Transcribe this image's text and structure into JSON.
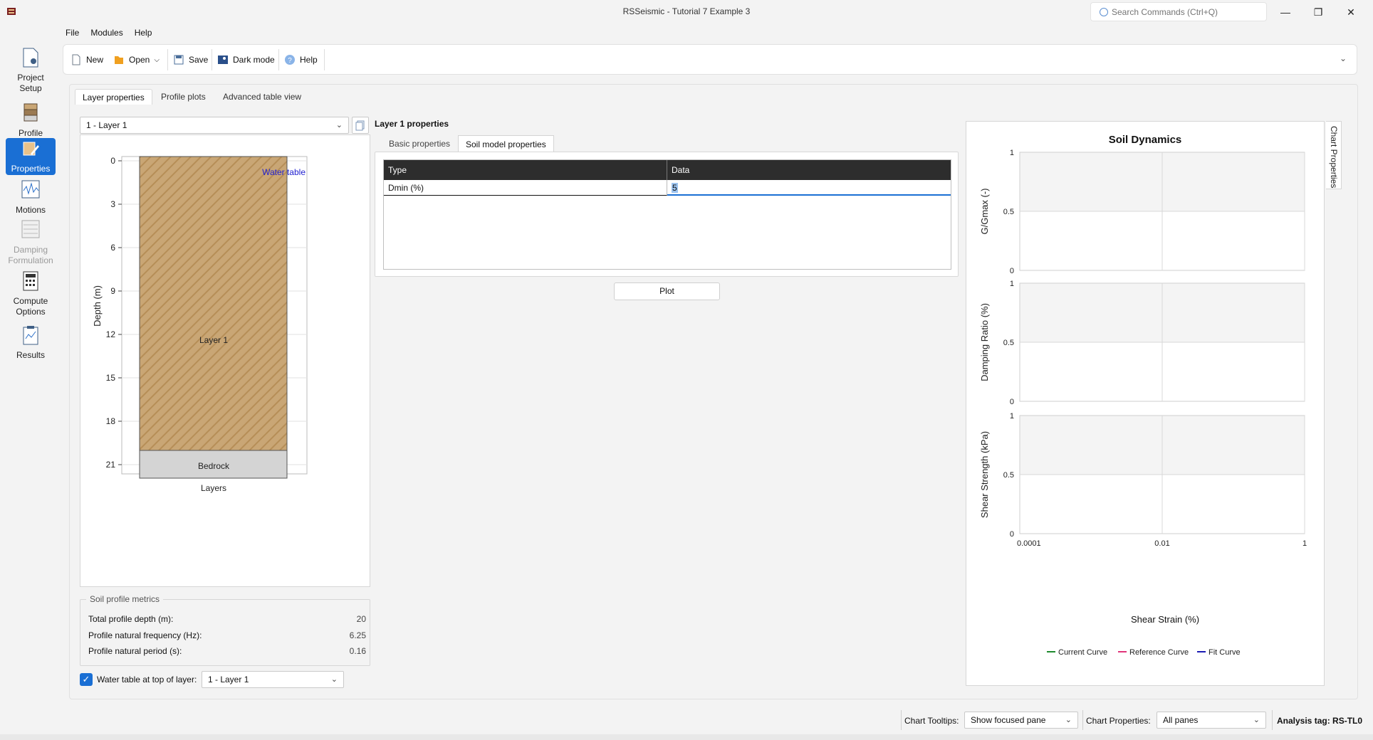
{
  "window": {
    "title": "RSSeismic - Tutorial 7 Example 3",
    "search_placeholder": "Search Commands (Ctrl+Q)"
  },
  "menu": [
    "File",
    "Modules",
    "Help"
  ],
  "toolbar": {
    "new_label": "New",
    "open_label": "Open",
    "save_label": "Save",
    "dark_mode_label": "Dark mode",
    "help_label": "Help"
  },
  "rail": [
    {
      "label": "Project Setup",
      "icon": "project-setup-icon",
      "state": "normal"
    },
    {
      "label": "Profile",
      "icon": "profile-icon",
      "state": "normal"
    },
    {
      "label": "Properties",
      "icon": "properties-icon",
      "state": "active"
    },
    {
      "label": "Motions",
      "icon": "motions-icon",
      "state": "normal"
    },
    {
      "label": "Damping Formulation",
      "icon": "damping-icon",
      "state": "disabled"
    },
    {
      "label": "Compute Options",
      "icon": "calculator-icon",
      "state": "normal"
    },
    {
      "label": "Results",
      "icon": "results-icon",
      "state": "normal"
    }
  ],
  "tabs": [
    "Layer properties",
    "Profile plots",
    "Advanced table view"
  ],
  "layer_select": {
    "value": "1 - Layer 1"
  },
  "profile": {
    "depth_ticks": [
      "0",
      "3",
      "6",
      "9",
      "12",
      "15",
      "18",
      "21"
    ],
    "ylabel": "Depth (m)",
    "xlabel": "Layers",
    "water_table_label": "Water table",
    "layer1_label": "Layer 1",
    "bedrock_label": "Bedrock",
    "layer1_color": "#c9a675",
    "bedrock_color": "#d4d4d4"
  },
  "metrics": {
    "title": "Soil profile metrics",
    "rows": [
      {
        "label": "Total profile depth (m):",
        "value": "20"
      },
      {
        "label": "Profile natural frequency (Hz):",
        "value": "6.25"
      },
      {
        "label": "Profile natural period (s):",
        "value": "0.16"
      }
    ]
  },
  "water_table": {
    "checkbox_label": "Water table at top of layer:",
    "checked": true,
    "select_value": "1 - Layer 1"
  },
  "properties": {
    "title": "Layer 1 properties",
    "subtabs": [
      "Basic properties",
      "Soil model properties"
    ],
    "grid_headers": [
      "Type",
      "Data"
    ],
    "rows": [
      {
        "type": "Dmin (%)",
        "data": "5"
      }
    ],
    "plot_button": "Plot"
  },
  "dynamics": {
    "title": "Soil Dynamics",
    "panes": [
      {
        "ylabel": "G/Gmax (-)",
        "yticks": [
          "1",
          "0.5",
          "0"
        ]
      },
      {
        "ylabel": "Damping Ratio (%)",
        "yticks": [
          "1",
          "0.5",
          "0"
        ]
      },
      {
        "ylabel": "Shear Strength (kPa)",
        "yticks": [
          "1",
          "0.5",
          "0"
        ]
      }
    ],
    "xticks": [
      "0.0001",
      "0.01",
      "1"
    ],
    "xlabel": "Shear Strain (%)",
    "legend": [
      {
        "name": "Current Curve",
        "color": "#1e8a2e"
      },
      {
        "name": "Reference Curve",
        "color": "#e0357a"
      },
      {
        "name": "Fit Curve",
        "color": "#1b1bb3"
      }
    ]
  },
  "chart_data": {
    "type": "line",
    "title": "Soil Dynamics",
    "xlabel": "Shear Strain (%)",
    "x_scale": "log",
    "xlim": [
      0.0001,
      1
    ],
    "series": [
      {
        "name": "Current Curve",
        "values": []
      },
      {
        "name": "Reference Curve",
        "values": []
      },
      {
        "name": "Fit Curve",
        "values": []
      }
    ],
    "ylim": [
      0,
      1
    ],
    "grid": true,
    "legend_position": "bottom"
  },
  "chart_properties_tab": "Chart Properties",
  "statusbar": {
    "tooltips_label": "Chart Tooltips:",
    "tooltips_value": "Show focused pane",
    "properties_label": "Chart Properties:",
    "properties_value": "All panes",
    "analysis_tag": "Analysis tag: RS-TL0"
  }
}
